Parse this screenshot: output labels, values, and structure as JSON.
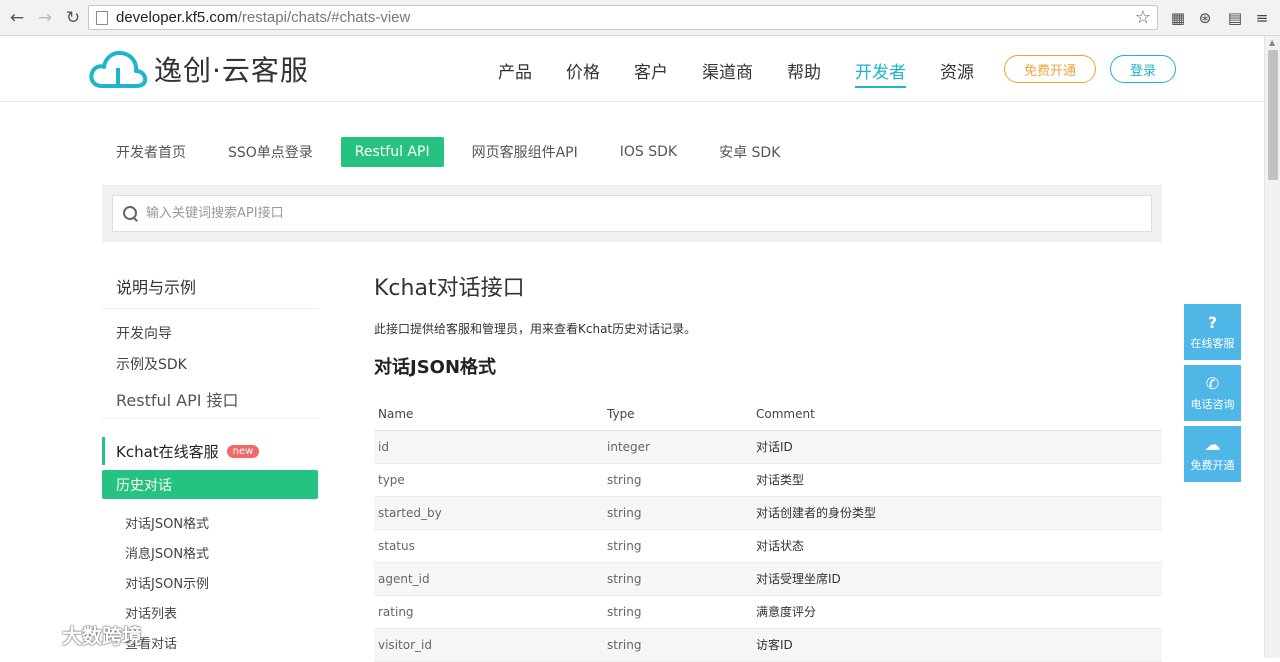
{
  "browser": {
    "url_host": "developer.kf5.com",
    "url_path": "/restapi/chats/#chats-view"
  },
  "header": {
    "logo_text": "逸创·云客服",
    "nav": [
      "产品",
      "价格",
      "客户",
      "渠道商",
      "帮助",
      "开发者",
      "资源"
    ],
    "active_nav": "开发者",
    "free_button": "免费开通",
    "login_button": "登录",
    "brand_color": "#1cb5c9",
    "accent_orange": "#f0a53a"
  },
  "subnav": {
    "items": [
      "开发者首页",
      "SSO单点登录",
      "Restful API",
      "网页客服组件API",
      "IOS SDK",
      "安卓 SDK"
    ],
    "active": "Restful API",
    "active_color": "#26c281"
  },
  "search": {
    "placeholder": "输入关键词搜索API接口"
  },
  "sidebar": {
    "heading": "说明与示例",
    "links": [
      "开发向导",
      "示例及SDK"
    ],
    "group": "Restful API 接口",
    "section": "Kchat在线客服",
    "badge": "new",
    "active_item": "历史对话",
    "sub_items": [
      "对话JSON格式",
      "消息JSON格式",
      "对话JSON示例",
      "对话列表",
      "查看对话"
    ]
  },
  "content": {
    "title": "Kchat对话接口",
    "description": "此接口提供给客服和管理员，用来查看Kchat历史对话记录。",
    "section_title": "对话JSON格式",
    "table": {
      "headers": [
        "Name",
        "Type",
        "Comment"
      ],
      "rows": [
        [
          "id",
          "integer",
          "对话ID"
        ],
        [
          "type",
          "string",
          "对话类型"
        ],
        [
          "started_by",
          "string",
          "对话创建者的身份类型"
        ],
        [
          "status",
          "string",
          "对话状态"
        ],
        [
          "agent_id",
          "string",
          "对话受理坐席ID"
        ],
        [
          "rating",
          "string",
          "满意度评分"
        ],
        [
          "visitor_id",
          "string",
          "访客ID"
        ]
      ]
    }
  },
  "float_buttons": [
    {
      "label": "在线客服",
      "icon": "question-icon"
    },
    {
      "label": "电话咨询",
      "icon": "phone-icon"
    },
    {
      "label": "免费开通",
      "icon": "cloud-icon"
    }
  ],
  "watermark": {
    "text": "大数跨境"
  }
}
